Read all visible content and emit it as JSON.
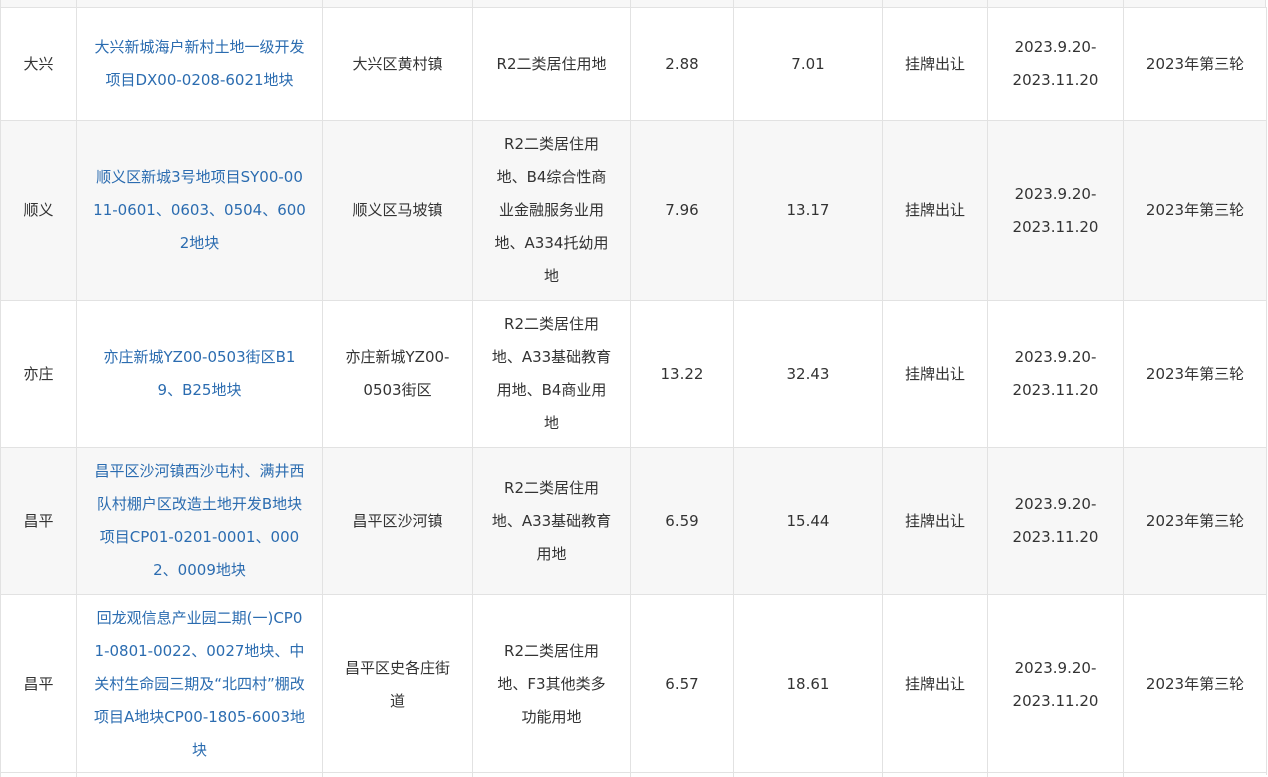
{
  "table": {
    "rows": [
      {
        "district": "大兴",
        "project": "大兴新城海户新村土地一级开发项目DX00-0208-6021地块",
        "location": "大兴区黄村镇",
        "land_use": "R2二类居住用地",
        "area": "2.88",
        "value": "7.01",
        "method": "挂牌出让",
        "period_start": "2023.9.20-",
        "period_end": "2023.11.20",
        "round": "2023年第三轮"
      },
      {
        "district": "顺义",
        "project": "顺义区新城3号地项目SY00-0011-0601、0603、0504、6002地块",
        "location": "顺义区马坡镇",
        "land_use": "R2二类居住用地、B4综合性商业金融服务业用地、A334托幼用地",
        "area": "7.96",
        "value": "13.17",
        "method": "挂牌出让",
        "period_start": "2023.9.20-",
        "period_end": "2023.11.20",
        "round": "2023年第三轮"
      },
      {
        "district": "亦庄",
        "project": "亦庄新城YZ00-0503街区B19、B25地块",
        "location": "亦庄新城YZ00-0503街区",
        "land_use": "R2二类居住用地、A33基础教育用地、B4商业用地",
        "area": "13.22",
        "value": "32.43",
        "method": "挂牌出让",
        "period_start": "2023.9.20-",
        "period_end": "2023.11.20",
        "round": "2023年第三轮"
      },
      {
        "district": "昌平",
        "project": "昌平区沙河镇西沙屯村、满井西队村棚户区改造土地开发B地块项目CP01-0201-0001、0002、0009地块",
        "location": "昌平区沙河镇",
        "land_use": "R2二类居住用地、A33基础教育用地",
        "area": "6.59",
        "value": "15.44",
        "method": "挂牌出让",
        "period_start": "2023.9.20-",
        "period_end": "2023.11.20",
        "round": "2023年第三轮"
      },
      {
        "district": "昌平",
        "project": "回龙观信息产业园二期(一)CP01-0801-0022、0027地块、中关村生命园三期及“北四村”棚改项目A地块CP00-1805-6003地块",
        "location": "昌平区史各庄街道",
        "land_use": "R2二类居住用地、F3其他类多功能用地",
        "area": "6.57",
        "value": "18.61",
        "method": "挂牌出让",
        "period_start": "2023.9.20-",
        "period_end": "2023.11.20",
        "round": "2023年第三轮"
      }
    ]
  }
}
